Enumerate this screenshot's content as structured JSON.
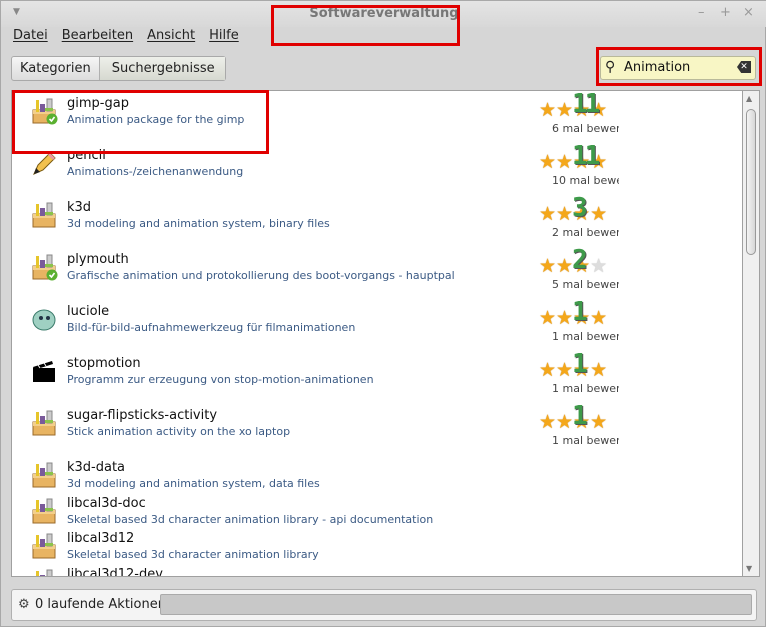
{
  "window": {
    "title": "Softwareverwaltung"
  },
  "menu": [
    "Datei",
    "Bearbeiten",
    "Ansicht",
    "Hilfe"
  ],
  "breadcrumb": {
    "categories": "Kategorien",
    "results": "Suchergebnisse"
  },
  "search": {
    "value": "Animation"
  },
  "packages": [
    {
      "name": "gimp-gap",
      "desc": "Animation package for the gimp",
      "stars": 4,
      "count": "6 mal bewer",
      "annotation": "11",
      "icon": "package-installed-icon"
    },
    {
      "name": "pencil",
      "desc": "Animations-/zeichenanwendung",
      "stars": 4,
      "count": "10 mal bewe",
      "annotation": "11",
      "icon": "pencil-icon"
    },
    {
      "name": "k3d",
      "desc": "3d modeling and animation system, binary files",
      "stars": 4,
      "count": "2 mal bewer",
      "annotation": "3",
      "icon": "package-icon"
    },
    {
      "name": "plymouth",
      "desc": "Grafische animation und protokollierung des boot-vorgangs - hauptpal",
      "stars": 3,
      "count": "5 mal bewer",
      "annotation": "2",
      "icon": "package-installed-icon"
    },
    {
      "name": "luciole",
      "desc": "Bild-für-bild-aufnahmewerkzeug für filmanimationen",
      "stars": 4,
      "count": "1 mal bewer",
      "annotation": "1",
      "icon": "luciole-icon"
    },
    {
      "name": "stopmotion",
      "desc": "Programm zur erzeugung von stop-motion-animationen",
      "stars": 4,
      "count": "1 mal bewer",
      "annotation": "1",
      "icon": "clapperboard-icon"
    },
    {
      "name": "sugar-flipsticks-activity",
      "desc": "Stick animation activity on the xo laptop",
      "stars": 4,
      "count": "1 mal bewer",
      "annotation": "1",
      "icon": "package-icon"
    },
    {
      "name": "k3d-data",
      "desc": "3d modeling and animation system, data files",
      "icon": "package-icon"
    },
    {
      "name": "libcal3d-doc",
      "desc": "Skeletal based 3d character animation library - api documentation",
      "icon": "package-icon"
    },
    {
      "name": "libcal3d12",
      "desc": "Skeletal based 3d character animation library",
      "icon": "package-icon"
    },
    {
      "name": "libcal3d12-dev",
      "desc": "",
      "icon": "package-icon"
    }
  ],
  "status": {
    "text": "0 laufende Aktionen",
    "progress": 0
  },
  "colors": {
    "highlight": "#e00000",
    "star": "#f4a71a",
    "annotation": "#3e9a4a",
    "search_bg": "#f8f6c5"
  }
}
